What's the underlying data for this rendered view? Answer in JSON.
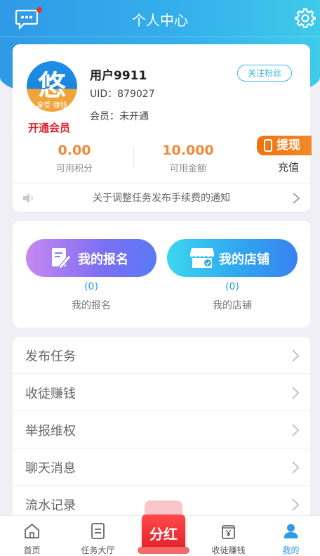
{
  "header": {
    "title": "个人中心",
    "message_icon": "chat-bubble-icon",
    "settings_icon": "gear-icon"
  },
  "profile": {
    "avatar_logo": "悠",
    "avatar_sub": "享受 赚钱",
    "vip_link": "开通会员",
    "username": "用户9911",
    "uid": "UID：879027",
    "member": "会员：未开通",
    "follow_label": "关注粉丝"
  },
  "wallet": {
    "points_value": "0.00",
    "points_label": "可用积分",
    "balance_value": "10.000",
    "balance_label": "可用金额",
    "withdraw_label": "提现",
    "recharge_label": "充值"
  },
  "notice": {
    "text": "关于调整任务发布手续费的通知"
  },
  "quick": {
    "signup_label": "我的报名",
    "signup_count": "(0)",
    "signup_caption": "我的报名",
    "shop_label": "我的店铺",
    "shop_count": "(0)",
    "shop_caption": "我的店铺"
  },
  "menu": [
    "发布任务",
    "收徒赚钱",
    "举报维权",
    "聊天消息",
    "流水记录"
  ],
  "tabbar": {
    "home": "首页",
    "tasks": "任务大厅",
    "center": "分红",
    "recruit": "收徒赚钱",
    "mine": "我的"
  },
  "colors": {
    "accent": "#2f9ae6",
    "orange": "#f08a39",
    "vip_red": "#d8222a"
  }
}
